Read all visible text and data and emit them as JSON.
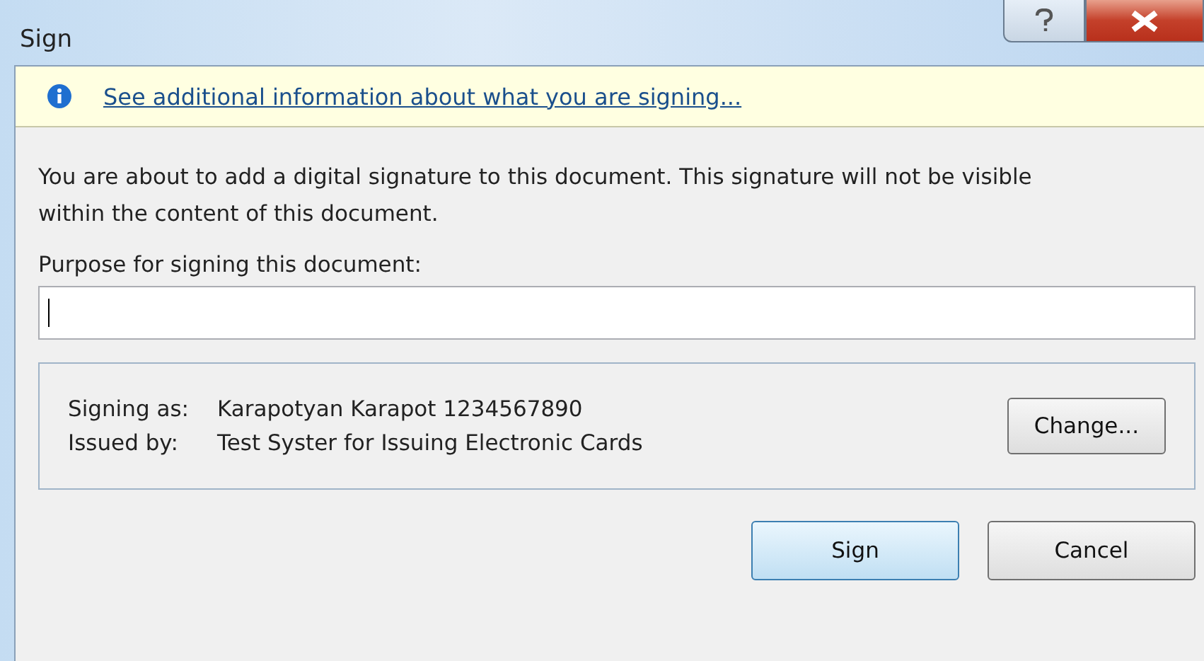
{
  "window": {
    "title": "Sign"
  },
  "info_bar": {
    "link": "See additional information about what you are signing..."
  },
  "message": "You are about to add a digital signature to this document. This signature will not be visible within the content of this document.",
  "purpose": {
    "label": "Purpose for signing this document:"
  },
  "certificate": {
    "rows": [
      {
        "label": "Signing as:",
        "value": "Karapotyan Karapot 1234567890"
      },
      {
        "label": "Issued by:",
        "value": "Test Syster for Issuing Electronic Cards"
      }
    ],
    "button": "Change..."
  },
  "buttons": [
    {
      "label": "Sign",
      "default": true
    },
    {
      "label": "Cancel",
      "default": false
    }
  ]
}
